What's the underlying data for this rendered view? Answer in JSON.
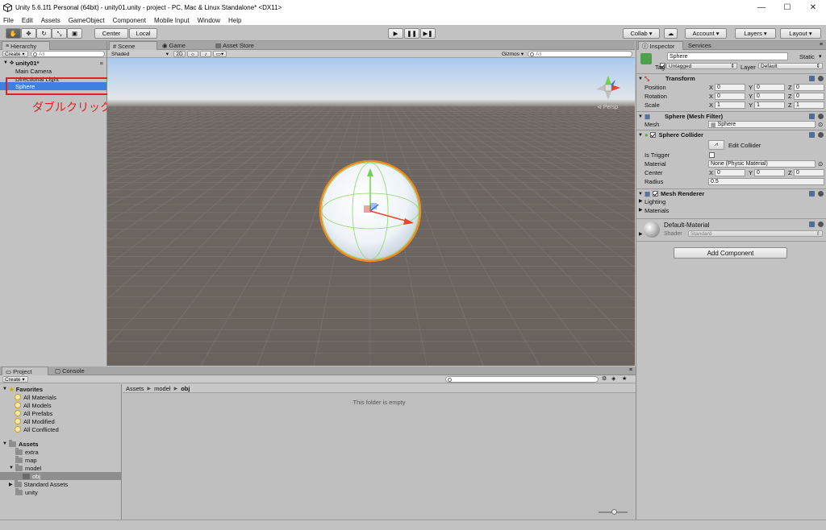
{
  "window": {
    "title": "Unity 5.6.1f1 Personal (64bit) - unity01.unity - project - PC, Mac & Linux Standalone* <DX11>",
    "min": "—",
    "max": "☐",
    "close": "✕"
  },
  "menu": [
    "File",
    "Edit",
    "Assets",
    "GameObject",
    "Component",
    "Mobile Input",
    "Window",
    "Help"
  ],
  "toolbar": {
    "center": "Center",
    "local": "Local",
    "collab": "Collab ▾",
    "account": "Account",
    "layers": "Layers",
    "layout": "Layout",
    "play": "▶",
    "pause": "❚❚",
    "step": "▶❚"
  },
  "hierarchy": {
    "tab": "Hierarchy",
    "create": "Create ▾",
    "search_placeholder": "All",
    "scene": "unity01*",
    "items": [
      "Main Camera",
      "Directional Light",
      "Sphere"
    ],
    "annotation": "ダブルクリックする",
    "annotation_color": "#e02020"
  },
  "scene": {
    "tabs": [
      "Scene",
      "Game",
      "Asset Store"
    ],
    "shaded": "Shaded",
    "twod": "2D",
    "gizmos": "Gizmos ▾",
    "search_placeholder": "All",
    "persp": "Persp"
  },
  "inspector": {
    "tabs": [
      "Inspector",
      "Services"
    ],
    "name": "Sphere",
    "static": "Static",
    "tag_label": "Tag",
    "tag_value": "Untagged",
    "layer_label": "Layer",
    "layer_value": "Default",
    "transform": {
      "title": "Transform",
      "rows": [
        {
          "label": "Position",
          "x": "0",
          "y": "0",
          "z": "0"
        },
        {
          "label": "Rotation",
          "x": "0",
          "y": "0",
          "z": "0"
        },
        {
          "label": "Scale",
          "x": "1",
          "y": "1",
          "z": "1"
        }
      ]
    },
    "mesh_filter": {
      "title": "Sphere (Mesh Filter)",
      "label": "Mesh",
      "value": "Sphere"
    },
    "collider": {
      "title": "Sphere Collider",
      "edit": "Edit Collider",
      "is_trigger": "Is Trigger",
      "material_label": "Material",
      "material_value": "None (Physic Material)",
      "center_label": "Center",
      "cx": "0",
      "cy": "0",
      "cz": "0",
      "radius_label": "Radius",
      "radius_value": "0.5"
    },
    "renderer": {
      "title": "Mesh Renderer",
      "lighting": "Lighting",
      "materials": "Materials"
    },
    "material": {
      "name": "Default-Material",
      "shader_label": "Shader",
      "shader_value": "Standard"
    },
    "add_component": "Add Component"
  },
  "project": {
    "tabs": [
      "Project",
      "Console"
    ],
    "create": "Create ▾",
    "favorites": "Favorites",
    "fav_items": [
      "All Materials",
      "All Models",
      "All Prefabs",
      "All Modified",
      "All Conflicted"
    ],
    "assets": "Assets",
    "asset_items": [
      "extra",
      "map",
      "model",
      "obj",
      "Standard Assets",
      "unity"
    ],
    "breadcrumb": [
      "Assets",
      "model",
      "obj"
    ],
    "empty": "This folder is empty"
  }
}
